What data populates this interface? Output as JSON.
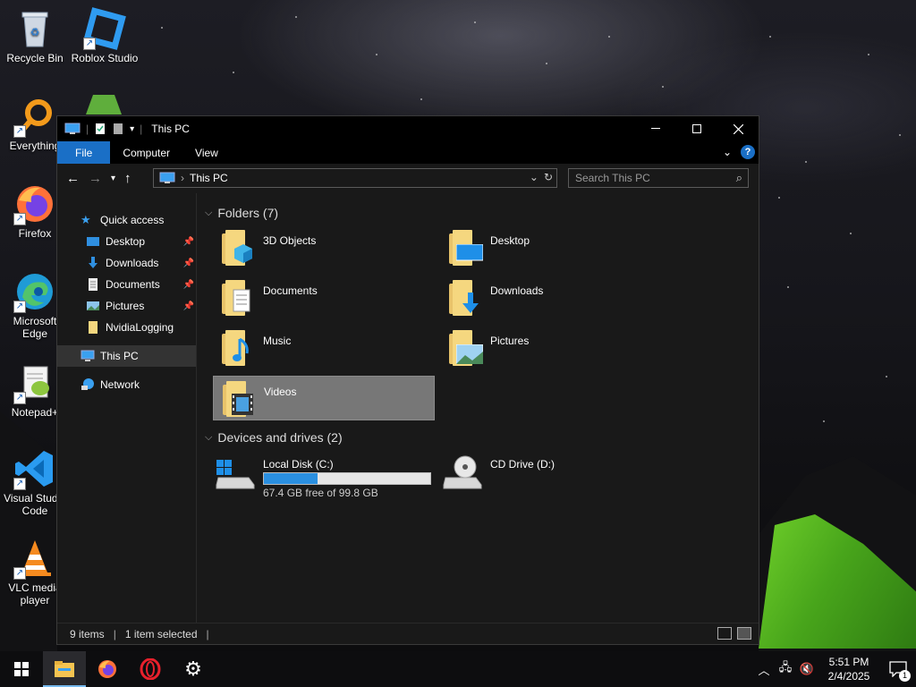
{
  "desktop": {
    "icons": [
      {
        "label": "Recycle Bin"
      },
      {
        "label": "Roblox Studio"
      },
      {
        "label": "Everything"
      },
      {
        "label": "Firefox"
      },
      {
        "label": "Microsoft Edge"
      },
      {
        "label": "Notepad+"
      },
      {
        "label": "Visual Studio Code"
      },
      {
        "label": "VLC media player"
      }
    ]
  },
  "window": {
    "title": "This PC",
    "ribbon": {
      "tabs": [
        "File",
        "Computer",
        "View"
      ],
      "active": "File"
    },
    "address": {
      "path": "This PC",
      "search_placeholder": "Search This PC"
    },
    "nav_pane": {
      "quick_access": "Quick access",
      "quick_items": [
        {
          "label": "Desktop",
          "pinned": true
        },
        {
          "label": "Downloads",
          "pinned": true
        },
        {
          "label": "Documents",
          "pinned": true
        },
        {
          "label": "Pictures",
          "pinned": true
        },
        {
          "label": "NvidiaLogging",
          "pinned": false
        }
      ],
      "this_pc": "This PC",
      "network": "Network"
    },
    "folders_header": "Folders (7)",
    "folders": [
      {
        "label": "3D Objects"
      },
      {
        "label": "Desktop"
      },
      {
        "label": "Documents"
      },
      {
        "label": "Downloads"
      },
      {
        "label": "Music"
      },
      {
        "label": "Pictures"
      },
      {
        "label": "Videos",
        "selected": true
      }
    ],
    "drives_header": "Devices and drives (2)",
    "drives": [
      {
        "label": "Local Disk (C:)",
        "free_text": "67.4 GB free of 99.8 GB",
        "used_fraction": 0.325
      },
      {
        "label": "CD Drive (D:)"
      }
    ],
    "status": {
      "items": "9 items",
      "selected": "1 item selected"
    }
  },
  "taskbar": {
    "clock_time": "5:51 PM",
    "clock_date": "2/4/2025",
    "notification_count": "1"
  },
  "colors": {
    "accent": "#1a6fc6",
    "selection": "#777777",
    "folder": "#f5d77f"
  }
}
